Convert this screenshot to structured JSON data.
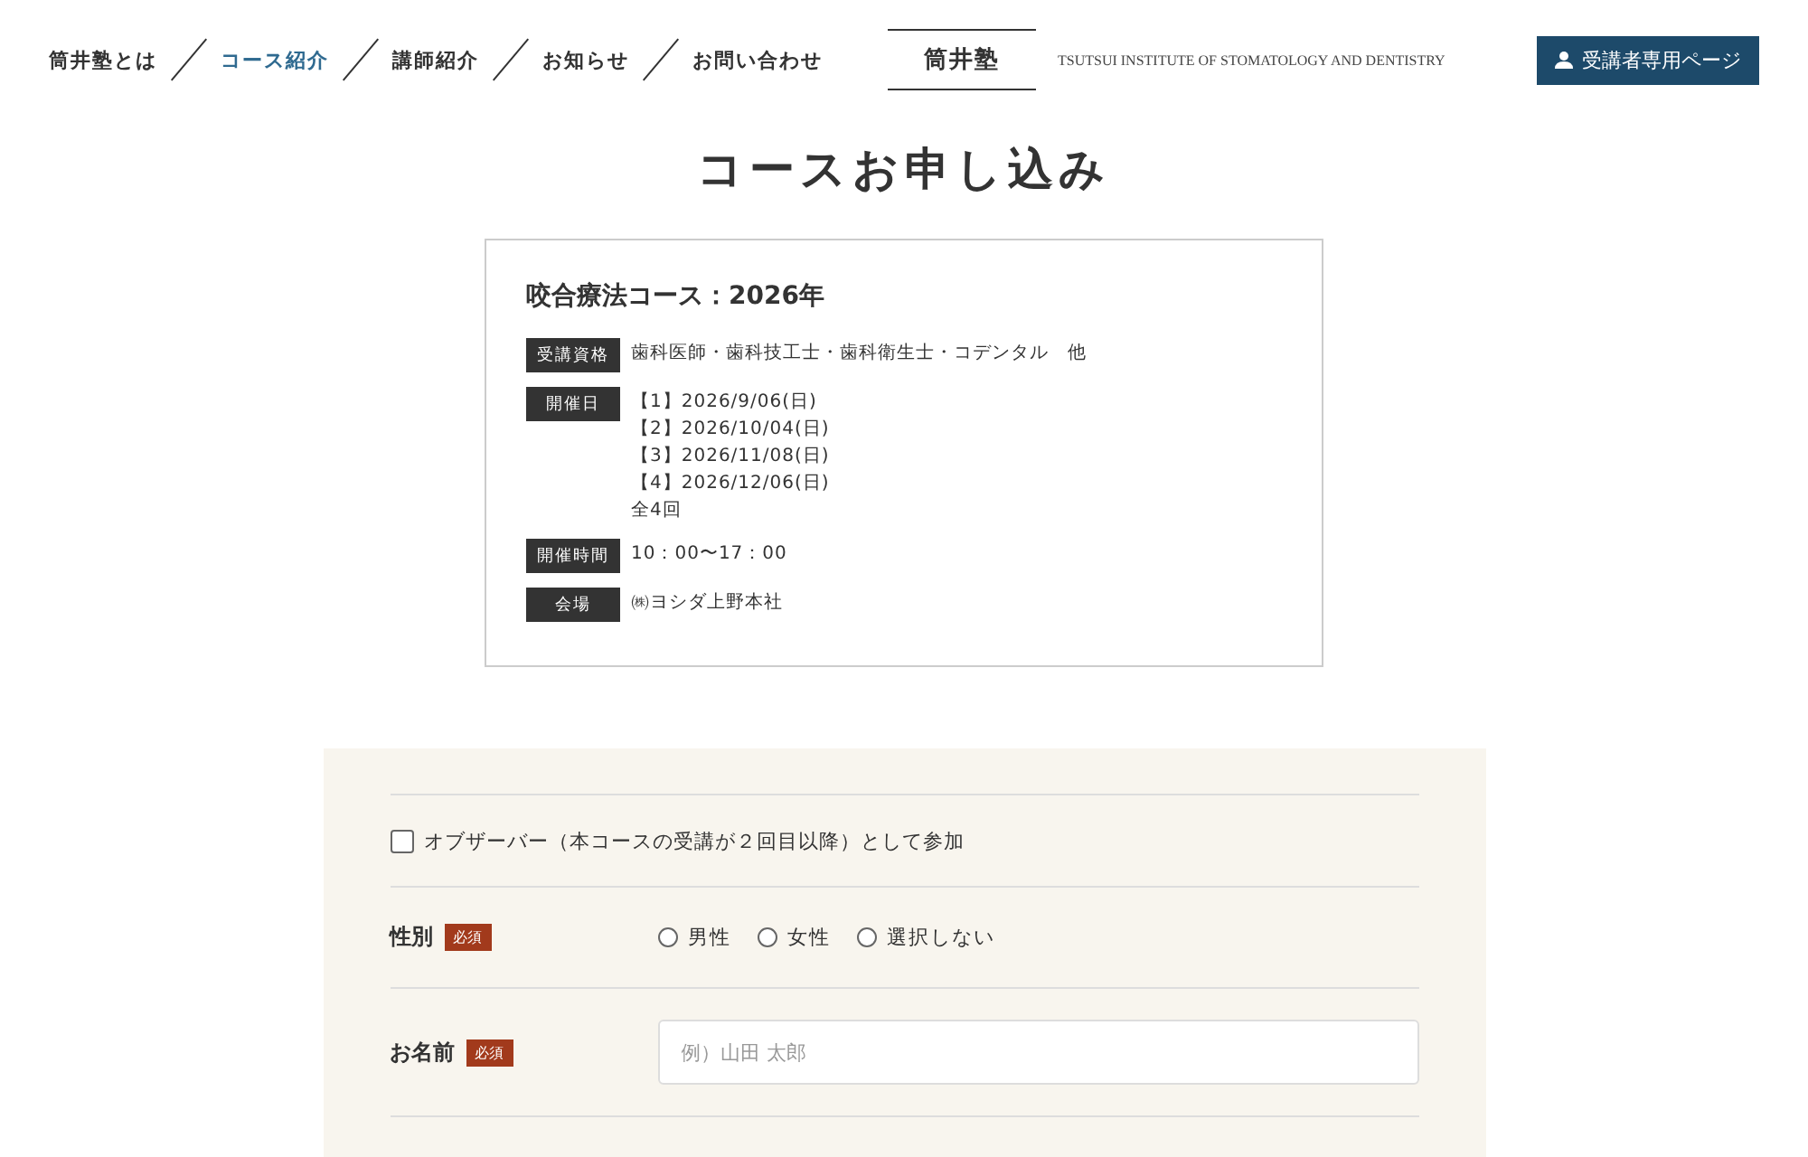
{
  "nav": [
    {
      "label": "筒井塾とは",
      "selected": false
    },
    {
      "label": "コース紹介",
      "selected": true
    },
    {
      "label": "講師紹介",
      "selected": false
    },
    {
      "label": "お知らせ",
      "selected": false
    },
    {
      "label": "お問い合わせ",
      "selected": false
    }
  ],
  "logo": {
    "name": "筒井塾",
    "tagline": "TSUTSUI INSTITUTE OF STOMATOLOGY AND DENTISTRY"
  },
  "member_button": "受講者専用ページ",
  "page_title": "コースお申し込み",
  "course": {
    "title": "咬合療法コース：2026年",
    "details": [
      {
        "label": "受講資格",
        "lines": [
          "歯科医師・歯科技工士・歯科衛生士・コデンタル　他"
        ]
      },
      {
        "label": "開催日",
        "lines": [
          "【1】2026/9/06(日)",
          "【2】2026/10/04(日)",
          "【3】2026/11/08(日)",
          "【4】2026/12/06(日)",
          "全4回"
        ]
      },
      {
        "label": "開催時間",
        "lines": [
          "10：00〜17：00"
        ]
      },
      {
        "label": "会場",
        "lines": [
          "㈱ヨシダ上野本社"
        ]
      }
    ]
  },
  "form": {
    "observer": {
      "label": "オブザーバー（本コースの受講が２回目以降）として参加",
      "checked": false
    },
    "fields": [
      {
        "kind": "radio",
        "label": "性別",
        "required": "必須",
        "options": [
          {
            "label": "男性",
            "selected": false
          },
          {
            "label": "女性",
            "selected": false
          },
          {
            "label": "選択しない",
            "selected": false
          }
        ]
      },
      {
        "kind": "text",
        "label": "お名前",
        "required": "必須",
        "placeholder": "例）山田 太郎"
      }
    ]
  }
}
